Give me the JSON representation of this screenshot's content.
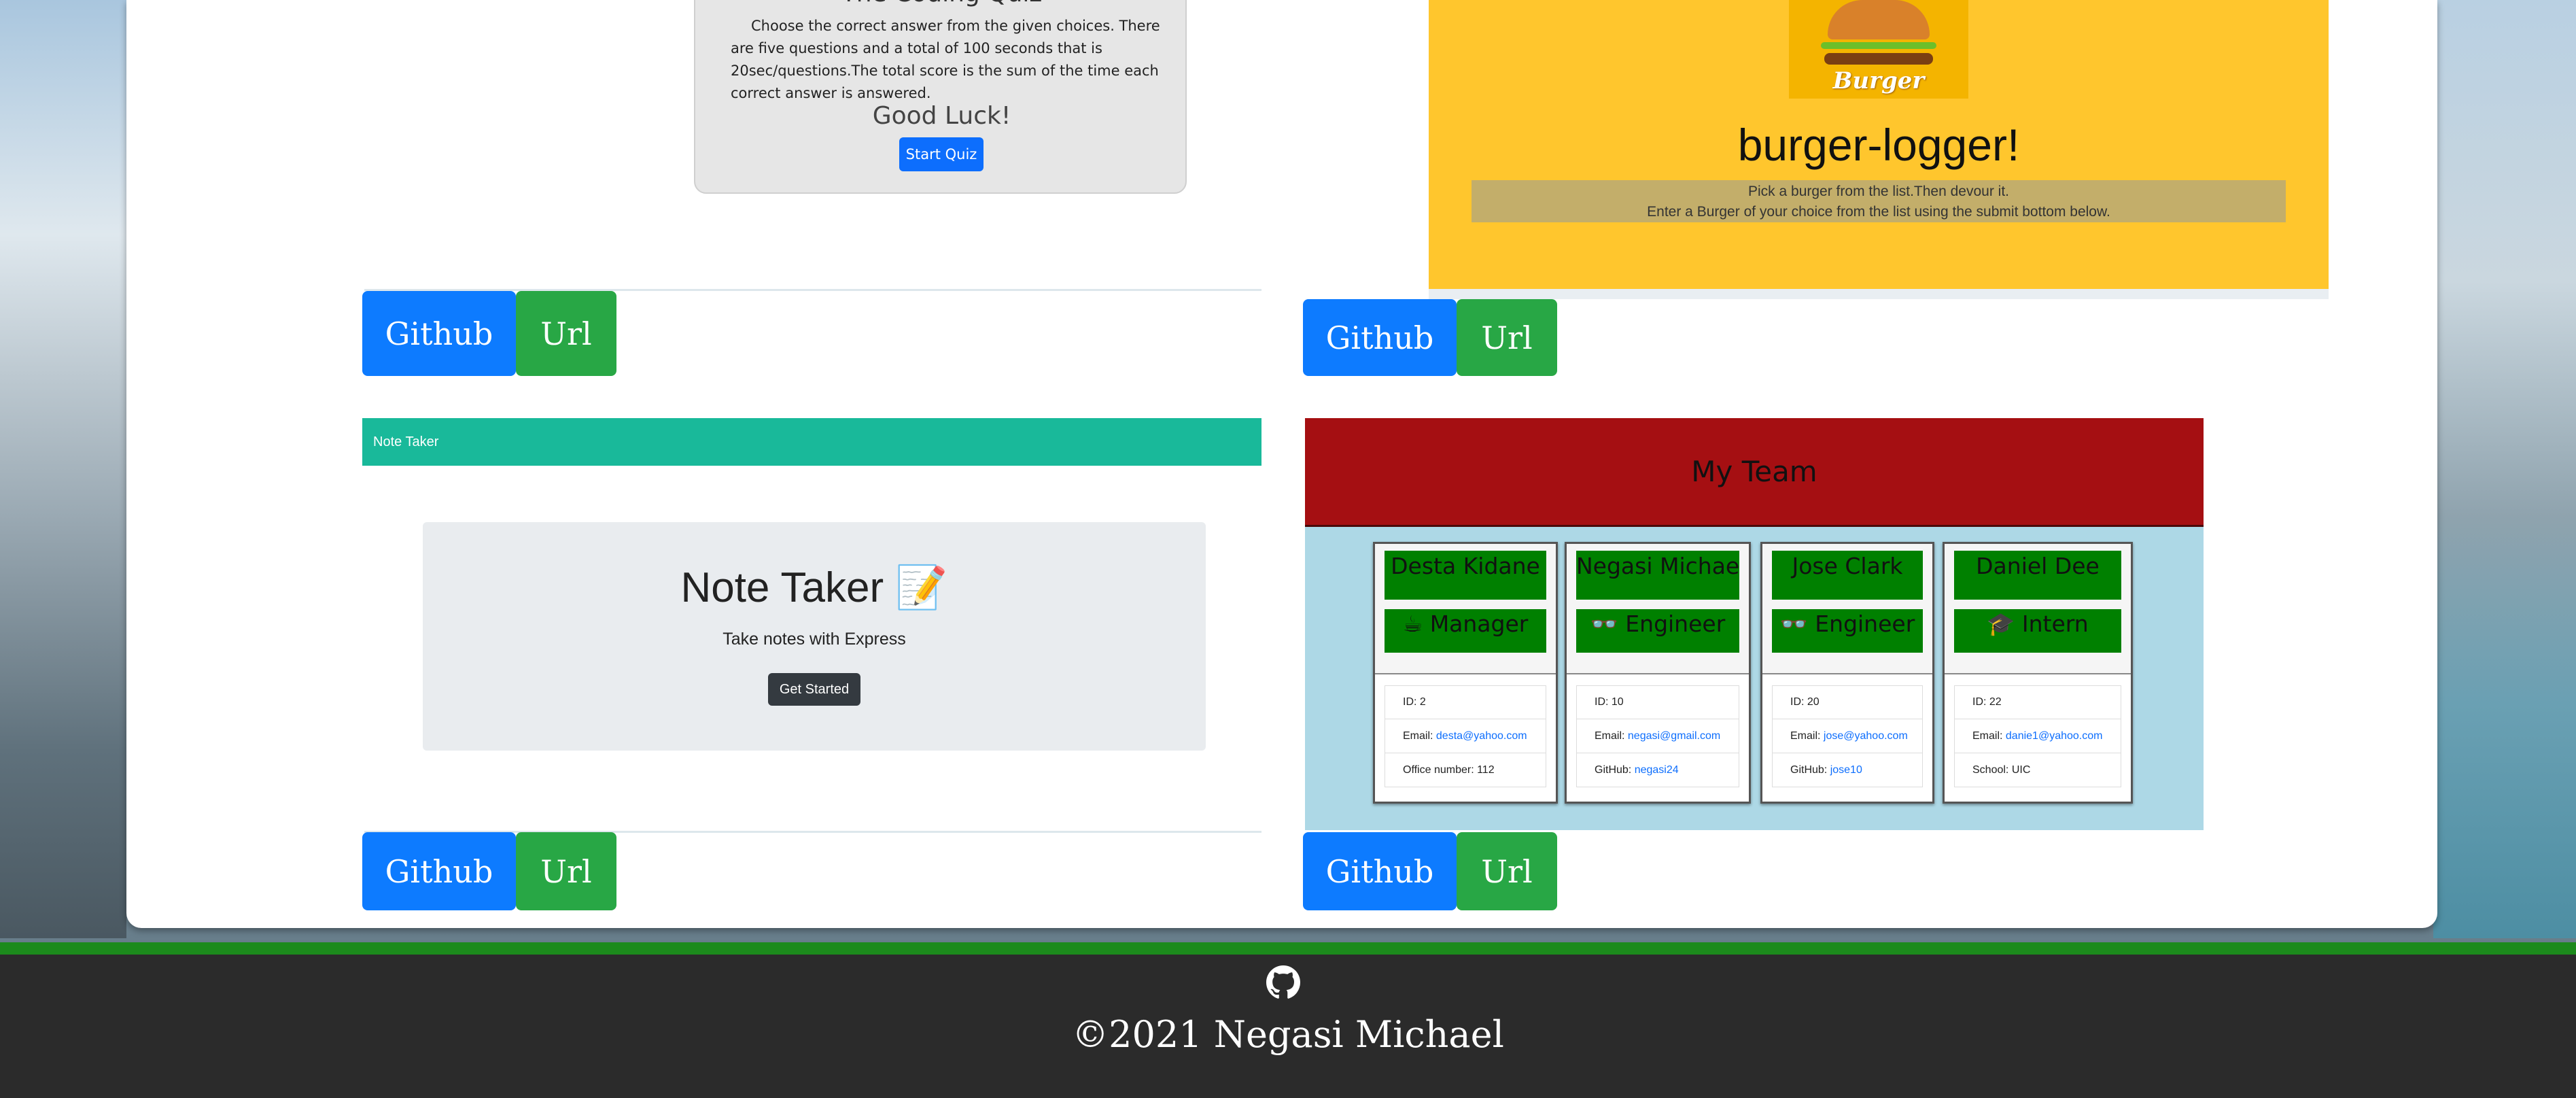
{
  "quiz": {
    "title": "The Coding Quiz",
    "description": "Choose the correct answer from the given choices. There are five questions and a total of 100 seconds that is 20sec/questions.The total score is the sum of the time each correct answer is answered.",
    "good_luck": "Good Luck!",
    "start_button": "Start Quiz"
  },
  "burger": {
    "logo_text": "Burger",
    "title": "burger-logger!",
    "line1": "Pick a burger from the list.Then devour it.",
    "line2": "Enter a Burger of your choice from the list using the submit bottom below."
  },
  "buttons": {
    "github": "Github",
    "url": "Url"
  },
  "note_taker": {
    "navbar": "Note Taker",
    "title": "Note Taker 📝",
    "subtitle": "Take notes with Express",
    "button": "Get Started"
  },
  "team": {
    "title": "My Team",
    "members": [
      {
        "name": "Desta Kidane",
        "role": "☕ Manager",
        "id": "ID: 2",
        "email_label": "Email: ",
        "email": "desta@yahoo.com",
        "extra_label": "Office number: 112",
        "extra_value": ""
      },
      {
        "name": "Negasi Michael",
        "role": "👓 Engineer",
        "id": "ID: 10",
        "email_label": "Email: ",
        "email": "negasi@gmail.com",
        "extra_label": "GitHub: ",
        "extra_value": "negasi24"
      },
      {
        "name": "Jose Clark",
        "role": "👓 Engineer",
        "id": "ID: 20",
        "email_label": "Email: ",
        "email": "jose@yahoo.com",
        "extra_label": "GitHub: ",
        "extra_value": "jose10"
      },
      {
        "name": "Daniel Dee",
        "role": "🎓 Intern",
        "id": "ID: 22",
        "email_label": "Email: ",
        "email": "danie1@yahoo.com",
        "extra_label": "School: UIC",
        "extra_value": ""
      }
    ]
  },
  "footer": {
    "icon": "github-icon",
    "copyright": "©2021 Negasi Michael"
  },
  "colors": {
    "github_btn": "#0d7bff",
    "url_btn": "#28a745",
    "note_bar": "#19b99a",
    "team_header": "#a50f12",
    "team_bg": "#add8e6",
    "footer_bg": "#2b2b2b",
    "footer_line": "#1c8a1c"
  }
}
